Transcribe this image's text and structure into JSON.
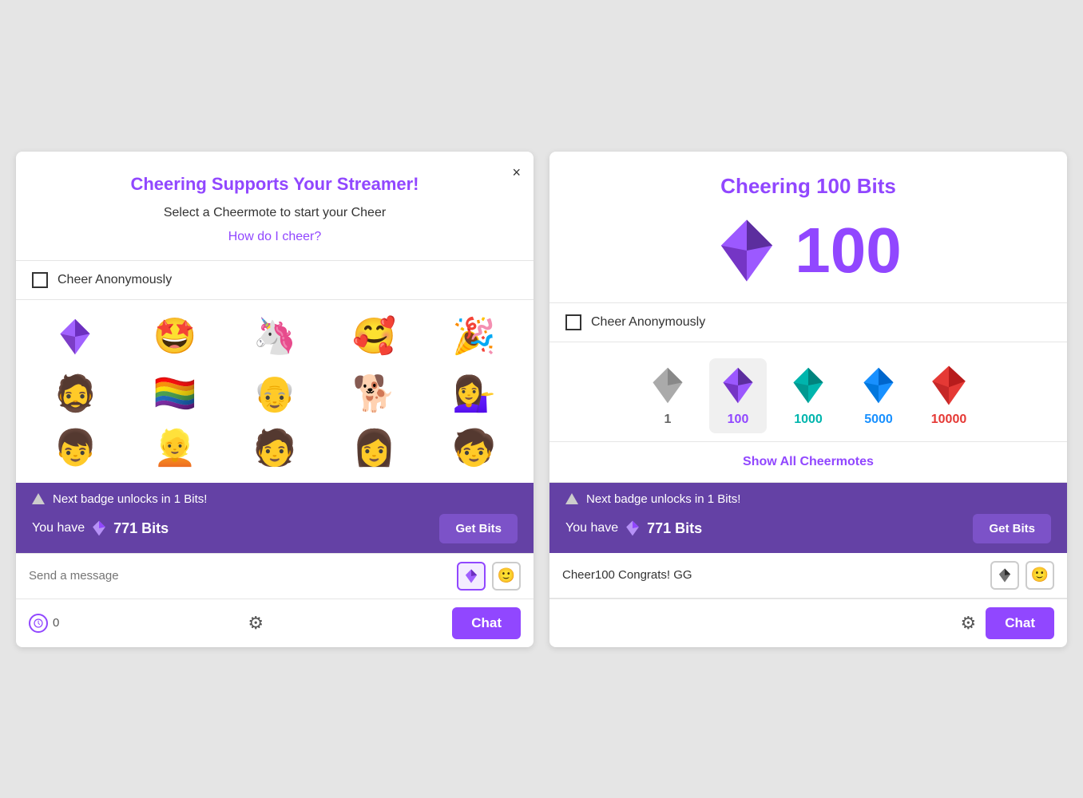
{
  "left_panel": {
    "title": "Cheering Supports Your Streamer!",
    "subtitle": "Select a Cheermote to start your Cheer",
    "how_to_link": "How do I cheer?",
    "close_label": "×",
    "anon_label": "Cheer Anonymously",
    "badge_unlock_text": "Next badge unlocks in 1 Bits!",
    "you_have_text": "You have",
    "bits_count": "771 Bits",
    "get_bits_label": "Get Bits",
    "message_placeholder": "Send a message",
    "slow_mode_count": "0",
    "chat_label": "Chat"
  },
  "right_panel": {
    "title_prefix": "Cheering ",
    "title_highlight": "100",
    "title_suffix": " Bits",
    "big_number": "100",
    "anon_label": "Cheer Anonymously",
    "tiers": [
      {
        "value": "1",
        "color": "gray"
      },
      {
        "value": "100",
        "color": "purple"
      },
      {
        "value": "1000",
        "color": "teal"
      },
      {
        "value": "5000",
        "color": "blue"
      },
      {
        "value": "10000",
        "color": "red"
      }
    ],
    "show_all_label": "Show All Cheermotes",
    "badge_unlock_text": "Next badge unlocks in 1 Bits!",
    "you_have_text": "You have",
    "bits_count": "771 Bits",
    "get_bits_label": "Get Bits",
    "message_value": "Cheer100 Congrats! GG",
    "chat_label": "Chat"
  },
  "cheermotes": [
    {
      "type": "diamond",
      "label": "diamond"
    },
    {
      "type": "face1",
      "label": "face1"
    },
    {
      "type": "unicorn",
      "label": "unicorn"
    },
    {
      "type": "heart",
      "label": "heart"
    },
    {
      "type": "party",
      "label": "party"
    },
    {
      "type": "face2",
      "label": "face2"
    },
    {
      "type": "pride",
      "label": "pride"
    },
    {
      "type": "face3",
      "label": "face3"
    },
    {
      "type": "dog",
      "label": "dog"
    },
    {
      "type": "face4",
      "label": "face4"
    },
    {
      "type": "face5",
      "label": "face5"
    },
    {
      "type": "face6",
      "label": "face6"
    },
    {
      "type": "face7",
      "label": "face7"
    },
    {
      "type": "face8",
      "label": "face8"
    },
    {
      "type": "face9",
      "label": "face9"
    }
  ]
}
